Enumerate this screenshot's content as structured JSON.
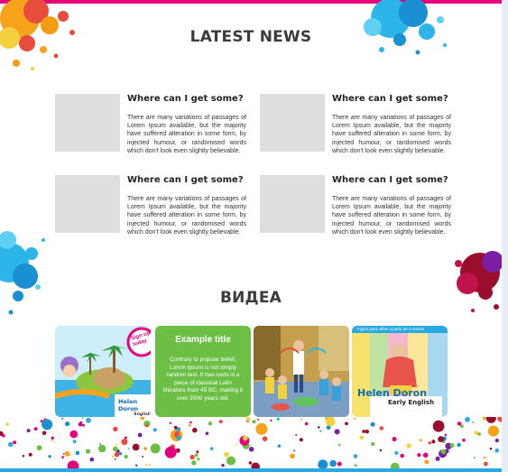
{
  "news_section": {
    "title": "LATEST NEWS",
    "items": [
      {
        "title": "Where can I get some?",
        "text": "There are many variations of passages of Lorem Ipsum available, but the majority have suffered alteration in some form, by injected humour, or randomised words which don't look even slightly believable."
      },
      {
        "title": "Where can I get some?",
        "text": "There are many variations of passages of Lorem Ipsum available, but the majority have suffered alteration in some form, by injected humour, or randomised words which don't look even slightly believable."
      },
      {
        "title": "Where can I get some?",
        "text": "There are many variations of passages of Lorem Ipsum available, but the majority have suffered alteration in some form, by injected humour, or randomised words which don't look even slightly believable."
      },
      {
        "title": "Where can I get some?",
        "text": "There are many variations of passages of Lorem Ipsum available, but the majority have suffered alteration in some form, by injected humour, or randomised words which don't look even slightly believable."
      }
    ]
  },
  "video_section": {
    "title": "ВИДЕА",
    "tiles": [
      {
        "kind": "illustration",
        "badge": "Sign up today",
        "logo_line1": "Helen Doron",
        "logo_line2": "English"
      },
      {
        "kind": "text",
        "title": "Example title",
        "text": "Contrary to popular belief, Lorem Ipsum is not simply random text. It has roots in a piece of classical Latin literature from 45 BC, making it over 2000 years old."
      },
      {
        "kind": "photo"
      },
      {
        "kind": "illustration",
        "caption": "Inglés para niños a partir de 3 meses",
        "logo_line1": "Helen Doron",
        "logo_line2": "Early English"
      }
    ]
  },
  "colors": {
    "top_bar": "#e6007e",
    "bottom_bar": "#29a9e1",
    "tile_green": "#6cbf45",
    "thumb_placeholder": "#dedede"
  }
}
